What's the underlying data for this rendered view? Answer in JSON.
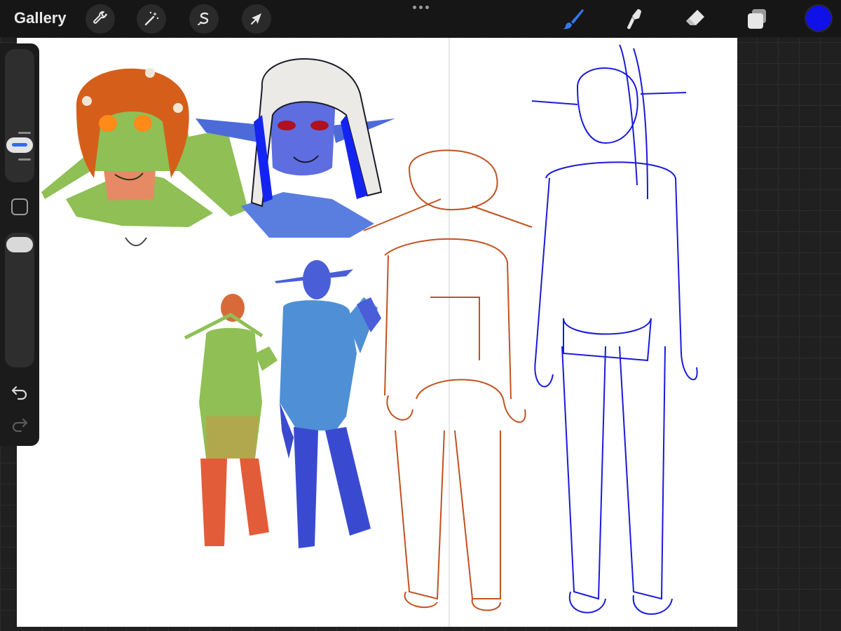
{
  "toolbar": {
    "gallery_label": "Gallery",
    "tools": [
      {
        "name": "actions",
        "icon": "wrench-icon"
      },
      {
        "name": "adjustments",
        "icon": "magic-wand-icon"
      },
      {
        "name": "selection",
        "icon": "selection-s-icon"
      },
      {
        "name": "transform",
        "icon": "arrow-cursor-icon"
      }
    ],
    "right_tools": [
      {
        "name": "brush",
        "icon": "brush-icon",
        "active": true
      },
      {
        "name": "smudge",
        "icon": "smudge-icon"
      },
      {
        "name": "eraser",
        "icon": "eraser-icon"
      },
      {
        "name": "layers",
        "icon": "layers-icon"
      }
    ],
    "current_color": "#1010e8",
    "accent_color": "#2f6cf0"
  },
  "sidebar": {
    "brush_size_level": 0.75,
    "opacity_level": 1.0,
    "undo_icon": "undo-arrow-icon",
    "redo_icon": "redo-arrow-icon"
  }
}
